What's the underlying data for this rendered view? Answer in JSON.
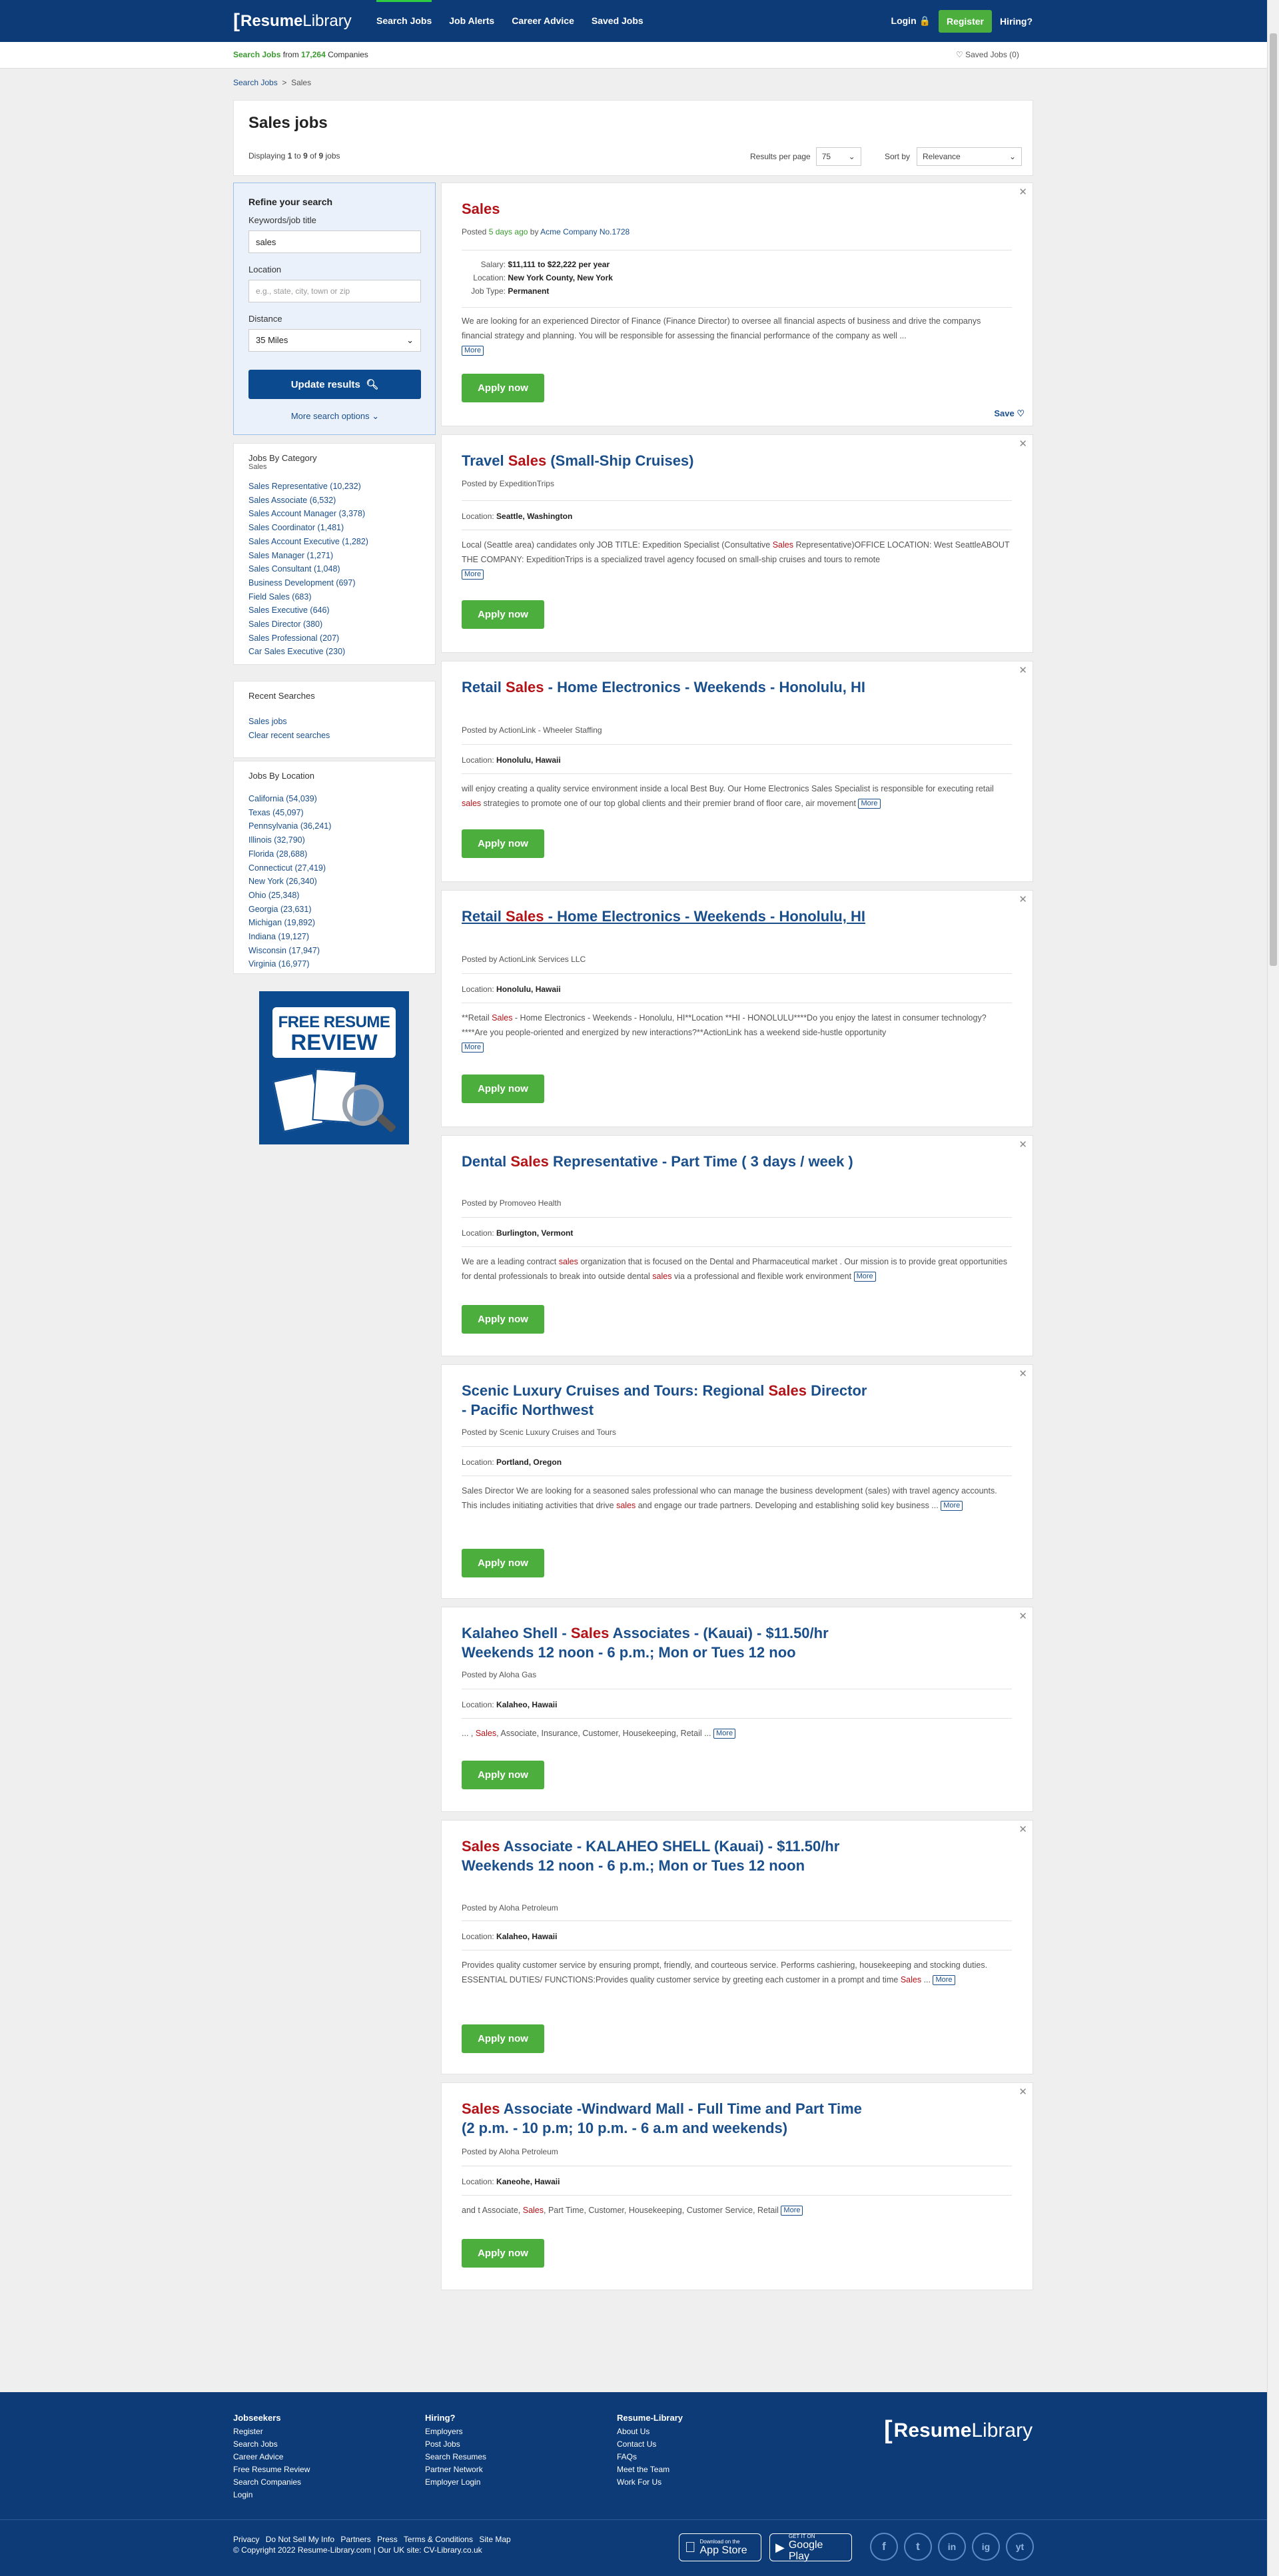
{
  "header": {
    "logo": {
      "bracket": "[",
      "bold": "Resume",
      "light": "Library"
    },
    "nav": [
      "Search Jobs",
      "Job Alerts",
      "Career Advice",
      "Saved Jobs"
    ],
    "login": "Login",
    "register": "Register",
    "hiring": "Hiring?"
  },
  "subbar": {
    "prefix": "Search Jobs",
    "from": " from ",
    "count": "17,264",
    "suffix": " Companies",
    "saved": "Saved Jobs (0)"
  },
  "breadcrumb": {
    "home": "Search Jobs",
    "sep": ">",
    "current": "Sales"
  },
  "results": {
    "title": "Sales jobs",
    "displaying": "Displaying",
    "from": "1",
    "to_word": "to",
    "to": "9",
    "of_word": "of",
    "total": "9",
    "jobs_word": "jobs",
    "per_page_label": "Results per page",
    "per_page": "75",
    "sort_label": "Sort by",
    "sort": "Relevance"
  },
  "refine": {
    "title": "Refine your search",
    "keywords_label": "Keywords/job title",
    "keywords_value": "sales",
    "location_label": "Location",
    "location_placeholder": "e.g., state, city, town or zip",
    "distance_label": "Distance",
    "distance_value": "35 Miles",
    "update_button": "Update results",
    "more_options": "More search options"
  },
  "categories": {
    "title": "Jobs By Category",
    "subtitle": "Sales",
    "items": [
      "Sales Representative (10,232)",
      "Sales Associate (6,532)",
      "Sales Account Manager (3,378)",
      "Sales Coordinator (1,481)",
      "Sales Account Executive (1,282)",
      "Sales Manager (1,271)",
      "Sales Consultant (1,048)",
      "Business Development (697)",
      "Field Sales (683)",
      "Sales Executive (646)",
      "Sales Director (380)",
      "Sales Professional (207)",
      "Car Sales Executive (230)"
    ]
  },
  "recent": {
    "title": "Recent Searches",
    "items": [
      "Sales jobs",
      "Clear recent searches"
    ]
  },
  "locations": {
    "title": "Jobs By Location",
    "items": [
      "California (54,039)",
      "Texas (45,097)",
      "Pennsylvania (36,241)",
      "Illinois (32,790)",
      "Florida (28,688)",
      "Connecticut (27,419)",
      "New York (26,340)",
      "Ohio (25,348)",
      "Georgia (23,631)",
      "Michigan (19,892)",
      "Indiana (19,127)",
      "Wisconsin (17,947)",
      "Virginia (16,977)"
    ]
  },
  "promo": {
    "line1": "FREE RESUME",
    "line2": "REVIEW"
  },
  "labels": {
    "posted_by": "Posted by",
    "posted": "Posted",
    "by": "by",
    "salary": "Salary:",
    "location": "Location:",
    "job_type": "Job Type:",
    "more": "More",
    "apply": "Apply now",
    "save": "Save"
  },
  "jobs": [
    {
      "title": [
        {
          "t": "Sales",
          "hl": true
        }
      ],
      "posted_ago": "5 days ago",
      "company": "Acme Company No.1728",
      "salary": "$11,111 to $22,222 per year",
      "location": "New York County, New York",
      "job_type": "Permanent",
      "desc": [
        {
          "t": "We are looking for an experienced Director of Finance (Finance Director) to oversee all financial aspects of business and drive the companys financial strategy and planning. You will be responsible for assessing the financial performance of the company as well ..."
        }
      ]
    },
    {
      "title": [
        {
          "t": "Travel "
        },
        {
          "t": "Sales",
          "hl": true
        },
        {
          "t": " (Small-Ship Cruises)"
        }
      ],
      "company": "ExpeditionTrips",
      "location": "Seattle, Washington",
      "desc": [
        {
          "t": "Local (Seattle area) candidates only JOB TITLE: Expedition Specialist (Consultative "
        },
        {
          "t": "Sales",
          "hl": true
        },
        {
          "t": " Representative)OFFICE LOCATION: West SeattleABOUT THE COMPANY: ExpeditionTrips is a specialized travel agency focused on small-ship cruises and tours to remote"
        }
      ]
    },
    {
      "title": [
        {
          "t": "Retail "
        },
        {
          "t": "Sales",
          "hl": true
        },
        {
          "t": " - Home Electronics - Weekends - Honolulu, HI"
        }
      ],
      "company": "ActionLink - Wheeler Staffing",
      "location": "Honolulu, Hawaii",
      "desc": [
        {
          "t": "will enjoy creating a quality service environment inside a local Best Buy. Our Home Electronics Sales Specialist is responsible for executing retail "
        },
        {
          "t": "sales",
          "hl": true
        },
        {
          "t": " strategies to promote one of our top global clients and their premier brand of floor care, air movement"
        }
      ]
    },
    {
      "title": [
        {
          "t": "Retail "
        },
        {
          "t": "Sales",
          "hl": true
        },
        {
          "t": " - Home Electronics - Weekends - Honolulu, HI"
        }
      ],
      "company": "ActionLink Services LLC",
      "location": "Honolulu, Hawaii",
      "desc": [
        {
          "t": "**Retail "
        },
        {
          "t": "Sales",
          "hl": true
        },
        {
          "t": " - Home Electronics - Weekends - Honolulu, HI**Location **HI - HONOLULU****Do you enjoy the latest in consumer technology?****Are you people-oriented and energized by new interactions?**ActionLink has a weekend side-hustle opportunity"
        }
      ]
    },
    {
      "title": [
        {
          "t": "Dental "
        },
        {
          "t": "Sales",
          "hl": true
        },
        {
          "t": " Representative - Part Time ( 3 days / week )"
        }
      ],
      "company": "Promoveo Health",
      "location": "Burlington, Vermont",
      "desc": [
        {
          "t": "We are a leading contract "
        },
        {
          "t": "sales",
          "hl": true
        },
        {
          "t": " organization that is focused on the Dental and Pharmaceutical market . Our mission is to provide great opportunities for dental professionals to break into outside dental "
        },
        {
          "t": "sales",
          "hl": true
        },
        {
          "t": " via a professional and flexible work environment"
        }
      ]
    },
    {
      "title": [
        {
          "t": "Scenic Luxury Cruises and Tours: Regional "
        },
        {
          "t": "Sales",
          "hl": true
        },
        {
          "t": " Director - Pacific Northwest"
        }
      ],
      "company": "Scenic Luxury Cruises and Tours",
      "location": "Portland, Oregon",
      "desc": [
        {
          "t": "Sales Director We are looking for a seasoned sales professional who can manage the business development (sales) with travel agency accounts. This includes initiating activities that drive "
        },
        {
          "t": "sales",
          "hl": true
        },
        {
          "t": " and engage our trade partners. Developing and establishing solid key business ..."
        }
      ]
    },
    {
      "title": [
        {
          "t": "Kalaheo Shell - "
        },
        {
          "t": "Sales",
          "hl": true
        },
        {
          "t": " Associates - (Kauai) - $11.50/hr Weekends 12 noon - 6 p.m.; Mon or Tues 12 noo"
        }
      ],
      "company": "Aloha Gas",
      "location": "Kalaheo, Hawaii",
      "desc": [
        {
          "t": "... , "
        },
        {
          "t": "Sales",
          "hl": true
        },
        {
          "t": ", Associate, Insurance, Customer, Housekeeping, Retail ..."
        }
      ]
    },
    {
      "title": [
        {
          "t": "Sales",
          "hl": true
        },
        {
          "t": " Associate - KALAHEO SHELL (Kauai) - $11.50/hr Weekends 12 noon - 6 p.m.; Mon or Tues 12 noon"
        }
      ],
      "company": "Aloha Petroleum",
      "location": "Kalaheo, Hawaii",
      "desc": [
        {
          "t": "Provides quality customer service by ensuring prompt, friendly, and courteous service. Performs cashiering, housekeeping and stocking duties. ESSENTIAL DUTIES/ FUNCTIONS:Provides quality customer service by greeting each customer in a prompt and time "
        },
        {
          "t": "Sales",
          "hl": true
        },
        {
          "t": " ..."
        }
      ]
    },
    {
      "title": [
        {
          "t": "Sales",
          "hl": true
        },
        {
          "t": " Associate -Windward Mall - Full Time and Part Time (2 p.m. - 10 p.m; 10 p.m. - 6 a.m and weekends)"
        }
      ],
      "company": "Aloha Petroleum",
      "location": "Kaneohe, Hawaii",
      "desc": [
        {
          "t": "and t Associate, "
        },
        {
          "t": "Sales",
          "hl": true
        },
        {
          "t": ", Part Time, Customer, Housekeeping, Customer Service, Retail"
        }
      ]
    }
  ],
  "footer": {
    "jobseekers": {
      "title": "Jobseekers",
      "items": [
        "Register",
        "Search Jobs",
        "Career Advice",
        "Free Resume Review",
        "Search Companies",
        "Login"
      ]
    },
    "hiring": {
      "title": "Hiring?",
      "items": [
        "Employers",
        "Post Jobs",
        "Search Resumes",
        "Partner Network",
        "Employer Login"
      ]
    },
    "resumelibrary": {
      "title": "Resume-Library",
      "items": [
        "About Us",
        "Contact Us",
        "FAQs",
        "Meet the Team",
        "Work For Us"
      ]
    },
    "bottom_links": [
      "Privacy",
      "Do Not Sell My Info",
      "Partners",
      "Press",
      "Terms & Conditions",
      "Site Map"
    ],
    "copyright": "© Copyright 2022 Resume-Library.com | Our UK site: CV-Library.co.uk",
    "appstore": {
      "small": "Download on the",
      "big": "App Store"
    },
    "googleplay": {
      "small": "GET IT ON",
      "big": "Google Play"
    },
    "social": [
      "f",
      "t",
      "in",
      "ig",
      "yt"
    ]
  }
}
